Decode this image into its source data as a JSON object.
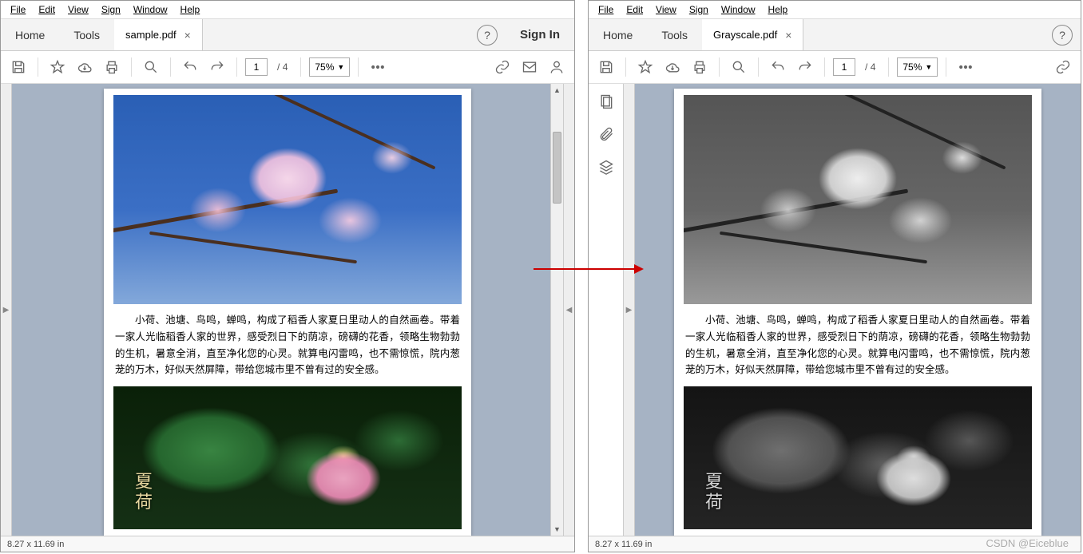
{
  "menus": {
    "file": "File",
    "edit": "Edit",
    "view": "View",
    "sign": "Sign",
    "window": "Window",
    "help": "Help"
  },
  "tabs": {
    "home": "Home",
    "tools": "Tools"
  },
  "left": {
    "filename": "sample.pdf"
  },
  "right": {
    "filename": "Grayscale.pdf"
  },
  "signin": "Sign In",
  "page": {
    "current": "1",
    "sep": "/",
    "total": "4"
  },
  "zoom": {
    "value": "75%"
  },
  "status": {
    "size": "8.27 x 11.69 in"
  },
  "doc": {
    "paragraph": "小荷、池塘、鸟鸣，蝉鸣，构成了稻香人家夏日里动人的自然画卷。带着一家人光临稻香人家的世界，感受烈日下的荫凉，磅礴的花香，领略生物勃勃的生机，暑意全消，直至净化您的心灵。就算电闪雷鸣，也不需惊慌，院内葱茏的万木，好似天然屏障，带给您城市里不曾有过的安全感。",
    "lotus_caption": "夏荷"
  },
  "watermark": "CSDN @Eiceblue"
}
